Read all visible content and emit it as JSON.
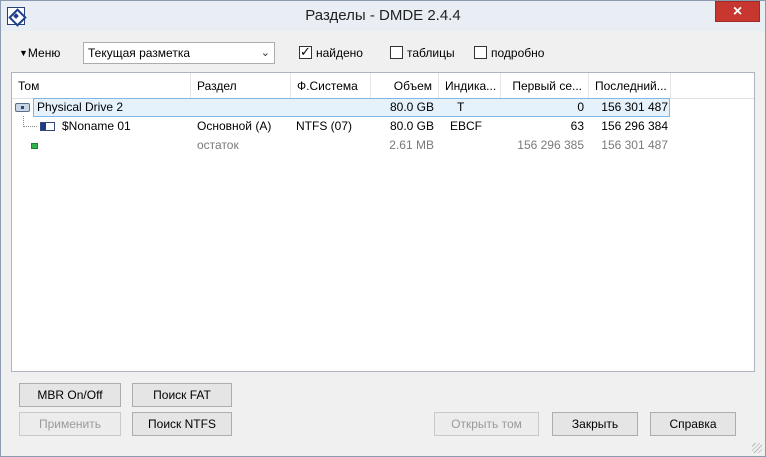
{
  "window": {
    "title": "Разделы - DMDE 2.4.4",
    "close_glyph": "×"
  },
  "toolbar": {
    "menu_label": "Меню",
    "layout_select": "Текущая разметка",
    "checks": [
      {
        "label": "найдено",
        "checked": true
      },
      {
        "label": "таблицы",
        "checked": false
      },
      {
        "label": "подробно",
        "checked": false
      }
    ]
  },
  "table": {
    "columns": [
      "Том",
      "Раздел",
      "Ф.Система",
      "Объем",
      "Индика...",
      "Первый се...",
      "Последний..."
    ],
    "rows": [
      {
        "tom": "Physical Drive 2",
        "razdel": "",
        "fs": "",
        "size": "80.0 GB",
        "ind": "T",
        "first": "0",
        "last": "156 301 487"
      },
      {
        "tom": "$Noname 01",
        "razdel": "Основной (A)",
        "fs": "NTFS (07)",
        "size": "80.0 GB",
        "ind": "EBCF",
        "first": "63",
        "last": "156 296 384"
      },
      {
        "tom": "",
        "razdel": "остаток",
        "fs": "",
        "size": "2.61 MB",
        "ind": "",
        "first": "156 296 385",
        "last": "156 301 487"
      }
    ]
  },
  "buttons": {
    "mbr": "MBR On/Off",
    "fat": "Поиск FAT",
    "apply": "Применить",
    "ntfs": "Поиск NTFS",
    "open": "Открыть том",
    "close": "Закрыть",
    "help": "Справка"
  }
}
